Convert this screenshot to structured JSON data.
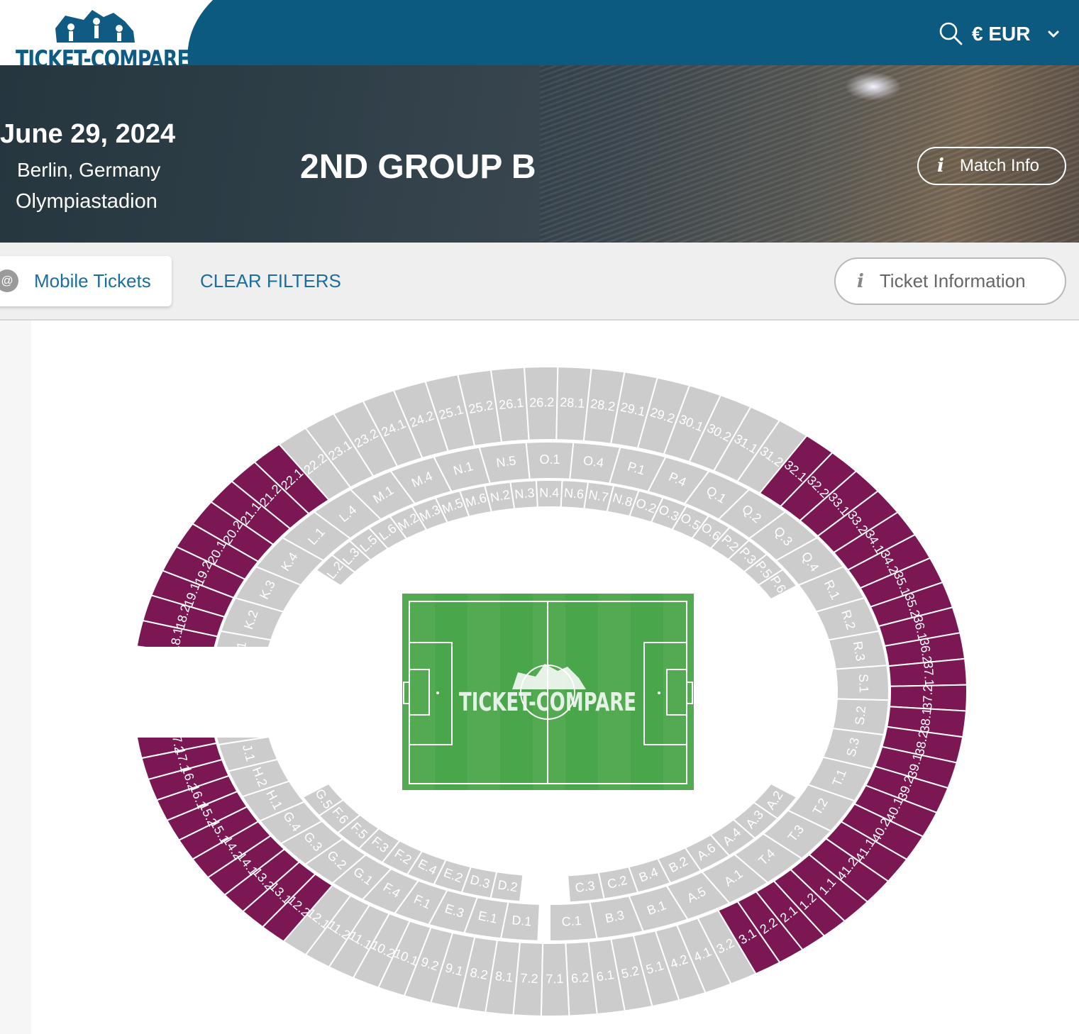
{
  "header": {
    "logo_text": "TICKET-COMPARE",
    "currency_label": "€ EUR",
    "icons": {
      "search": "search-icon",
      "chevron": "chevron-down-icon"
    }
  },
  "event": {
    "date": "June 29, 2024",
    "city": "Berlin, Germany",
    "venue": "Olympiastadion",
    "title": "2ND GROUP B",
    "match_info_label": "Match Info"
  },
  "filters": {
    "mobile_tickets_label": "Mobile Tickets",
    "mobile_icon_glyph": "@",
    "clear_filters_label": "CLEAR FILTERS",
    "ticket_info_label": "Ticket Information"
  },
  "colors": {
    "header_blue": "#0d5a80",
    "available_section": "#7b1752",
    "unavailable_section": "#cccccc",
    "pitch": "#4aa64a"
  },
  "stadium": {
    "pitch_logo_text": "TICKET-COMPARE",
    "outer_ring": [
      {
        "label": "1.2",
        "available": true
      },
      {
        "label": "2.1",
        "available": true
      },
      {
        "label": "2.2",
        "available": true
      },
      {
        "label": "3.1",
        "available": true
      },
      {
        "label": "3.2",
        "available": false
      },
      {
        "label": "4.1",
        "available": false
      },
      {
        "label": "4.2",
        "available": false
      },
      {
        "label": "5.1",
        "available": false
      },
      {
        "label": "5.2",
        "available": false
      },
      {
        "label": "6.1",
        "available": false
      },
      {
        "label": "6.2",
        "available": false
      },
      {
        "label": "7.1",
        "available": false
      },
      {
        "label": "7.2",
        "available": false
      },
      {
        "label": "8.1",
        "available": false
      },
      {
        "label": "8.2",
        "available": false
      },
      {
        "label": "9.1",
        "available": false
      },
      {
        "label": "9.2",
        "available": false
      },
      {
        "label": "10.1",
        "available": false
      },
      {
        "label": "10.2",
        "available": false
      },
      {
        "label": "11.1",
        "available": false
      },
      {
        "label": "11.2",
        "available": false
      },
      {
        "label": "12.1",
        "available": false
      },
      {
        "label": "12.2",
        "available": true
      },
      {
        "label": "13.1",
        "available": true
      },
      {
        "label": "13.2",
        "available": true
      },
      {
        "label": "14.1",
        "available": true
      },
      {
        "label": "14.2",
        "available": true
      },
      {
        "label": "15.1",
        "available": true
      },
      {
        "label": "15.2",
        "available": true
      },
      {
        "label": "16.1",
        "available": true
      },
      {
        "label": "16.2",
        "available": true
      },
      {
        "label": "17.1",
        "available": true
      },
      {
        "label": "17.2",
        "available": true
      },
      {
        "label": "18.1",
        "available": true
      },
      {
        "label": "18.2",
        "available": true
      },
      {
        "label": "19.1",
        "available": true
      },
      {
        "label": "19.2",
        "available": true
      },
      {
        "label": "20.1",
        "available": true
      },
      {
        "label": "20.2",
        "available": true
      },
      {
        "label": "21.1",
        "available": true
      },
      {
        "label": "21.2",
        "available": true
      },
      {
        "label": "22.1",
        "available": true
      },
      {
        "label": "22.2",
        "available": false
      },
      {
        "label": "23.1",
        "available": false
      },
      {
        "label": "23.2",
        "available": false
      },
      {
        "label": "24.1",
        "available": false
      },
      {
        "label": "24.2",
        "available": false
      },
      {
        "label": "25.1",
        "available": false
      },
      {
        "label": "25.2",
        "available": false
      },
      {
        "label": "26.1",
        "available": false
      },
      {
        "label": "26.2",
        "available": false
      },
      {
        "label": "28.1",
        "available": false
      },
      {
        "label": "28.2",
        "available": false
      },
      {
        "label": "29.1",
        "available": false
      },
      {
        "label": "29.2",
        "available": false
      },
      {
        "label": "30.1",
        "available": false
      },
      {
        "label": "30.2",
        "available": false
      },
      {
        "label": "31.1",
        "available": false
      },
      {
        "label": "31.2",
        "available": false
      },
      {
        "label": "32.1",
        "available": true
      },
      {
        "label": "32.2",
        "available": true
      },
      {
        "label": "33.1",
        "available": true
      },
      {
        "label": "33.2",
        "available": true
      },
      {
        "label": "34.1",
        "available": true
      },
      {
        "label": "34.2",
        "available": true
      },
      {
        "label": "35.1",
        "available": true
      },
      {
        "label": "35.2",
        "available": true
      },
      {
        "label": "36.1",
        "available": true
      },
      {
        "label": "36.2",
        "available": true
      },
      {
        "label": "37.1",
        "available": true
      },
      {
        "label": "37.2",
        "available": true
      },
      {
        "label": "38.1",
        "available": true
      },
      {
        "label": "38.2",
        "available": true
      },
      {
        "label": "39.1",
        "available": true
      },
      {
        "label": "39.2",
        "available": true
      },
      {
        "label": "40.1",
        "available": true
      },
      {
        "label": "40.2",
        "available": true
      },
      {
        "label": "41.1",
        "available": true
      },
      {
        "label": "41.2",
        "available": true
      },
      {
        "label": "1.1",
        "available": true
      }
    ],
    "middle_ring": [
      "D.1",
      "E.1",
      "E.3",
      "F.1",
      "F.4",
      "G.1",
      "G.2",
      "G.3",
      "G.4",
      "H.1",
      "H.2",
      "J.1",
      "J.2",
      "K.1",
      "K.2",
      "K.3",
      "K.4",
      "L.1",
      "L.4",
      "M.1",
      "M.4",
      "N.1",
      "N.5",
      "O.1",
      "O.4",
      "P.1",
      "P.4",
      "Q.1",
      "Q.2",
      "Q.3",
      "Q.4",
      "R.1",
      "R.2",
      "R.3",
      "S.1",
      "S.2",
      "S.3",
      "T.1",
      "T.2",
      "T.3",
      "T.4",
      "A.1",
      "A.5",
      "B.1",
      "B.3",
      "C.1"
    ],
    "inner_ring": [
      "D.2",
      "D.3",
      "E.2",
      "E.4",
      "F.2",
      "F.3",
      "F.5",
      "F.6",
      "G.5",
      "L.2",
      "L.3",
      "L.5",
      "L.6",
      "M.2",
      "M.3",
      "M.5",
      "M.6",
      "N.2",
      "N.3",
      "N.4",
      "N.6",
      "N.7",
      "N.8",
      "O.2",
      "O.3",
      "O.5",
      "O.6",
      "P.2",
      "P.3",
      "P.5",
      "P.6",
      "A.2",
      "A.3",
      "A.4",
      "A.6",
      "B.2",
      "B.4",
      "C.2",
      "C.3"
    ]
  }
}
